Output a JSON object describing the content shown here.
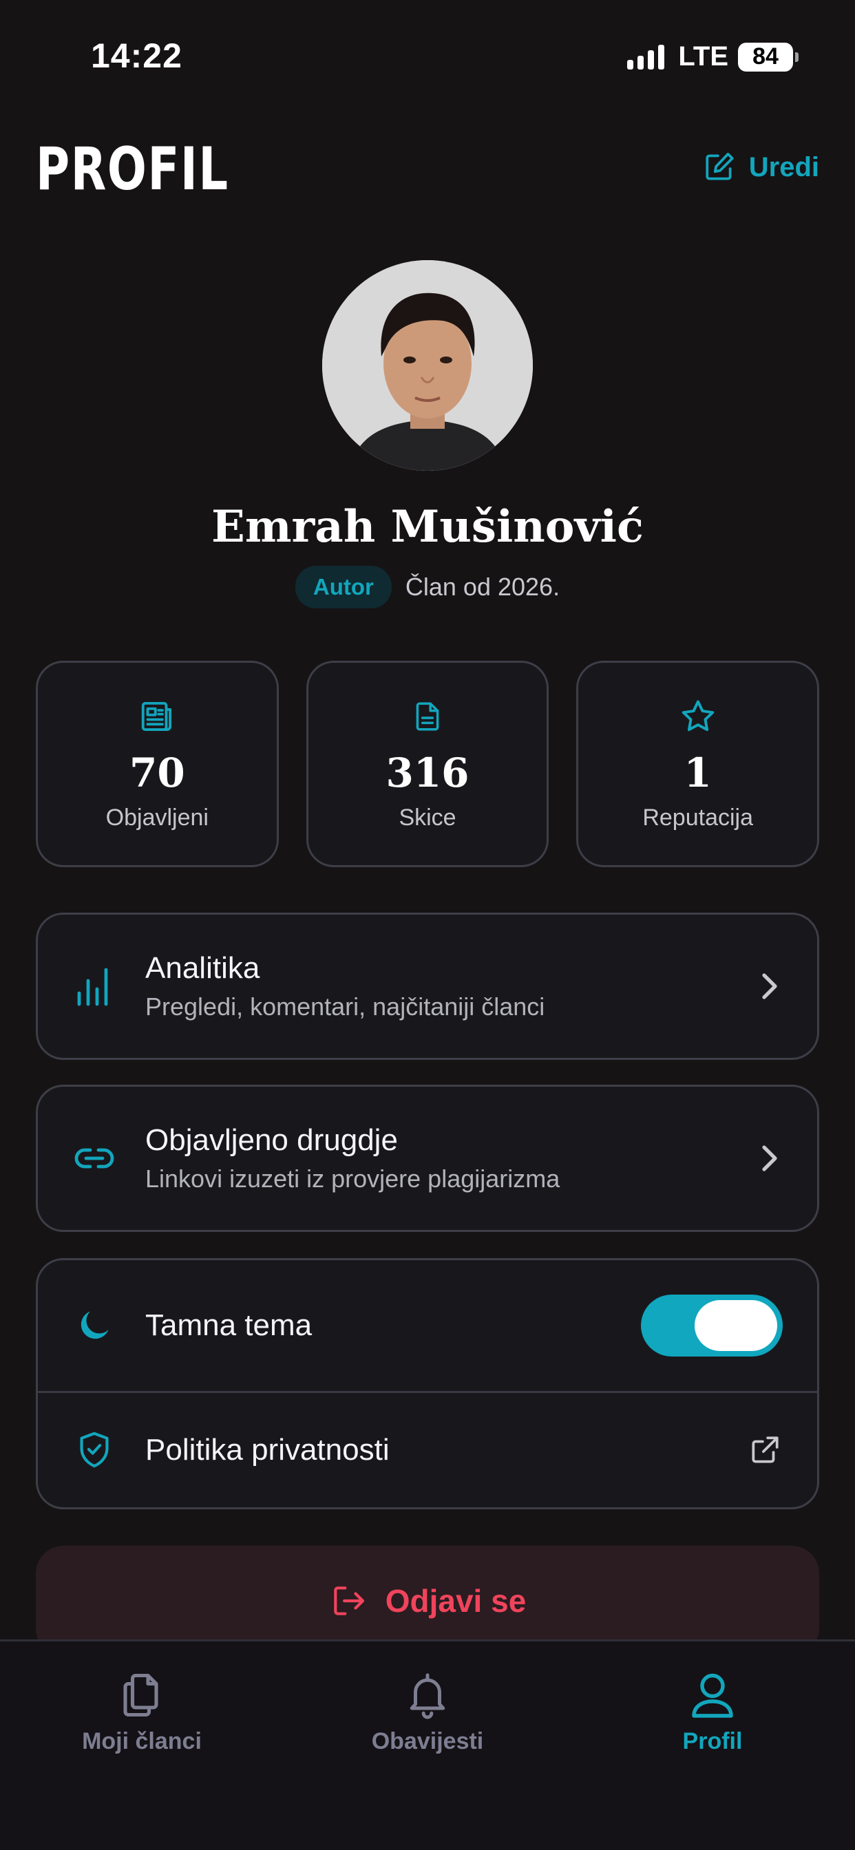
{
  "status_bar": {
    "time": "14:22",
    "network": "LTE",
    "battery": "84"
  },
  "header": {
    "title": "PROFIL",
    "edit_label": "Uredi",
    "edit_icon": "edit-square-icon"
  },
  "profile": {
    "name": "Emrah Mušinović",
    "role": "Autor",
    "member_since": "Član od 2026."
  },
  "stats": [
    {
      "icon": "newspaper-icon",
      "value": "70",
      "label": "Objavljeni"
    },
    {
      "icon": "document-icon",
      "value": "316",
      "label": "Skice"
    },
    {
      "icon": "star-icon",
      "value": "1",
      "label": "Reputacija"
    }
  ],
  "menu": {
    "analytics": {
      "icon": "bar-chart-icon",
      "title": "Analitika",
      "subtitle": "Pregledi, komentari, najčitaniji članci"
    },
    "published_elsewhere": {
      "icon": "link-icon",
      "title": "Objavljeno drugdje",
      "subtitle": "Linkovi izuzeti iz provjere plagijarizma"
    }
  },
  "settings": {
    "dark_theme": {
      "icon": "moon-icon",
      "label": "Tamna tema",
      "enabled": true
    },
    "privacy": {
      "icon": "shield-check-icon",
      "label": "Politika privatnosti",
      "trailing_icon": "external-link-icon"
    }
  },
  "logout": {
    "label": "Odjavi se",
    "icon": "logout-icon"
  },
  "bottom_nav": [
    {
      "label": "Moji članci",
      "icon": "documents-icon",
      "active": false
    },
    {
      "label": "Obavijesti",
      "icon": "bell-icon",
      "active": false
    },
    {
      "label": "Profil",
      "icon": "user-icon",
      "active": true
    }
  ],
  "colors": {
    "accent": "#12a6bd",
    "danger": "#f0445c",
    "background": "#161315",
    "card": "#18181c",
    "border": "#3e3e48"
  }
}
